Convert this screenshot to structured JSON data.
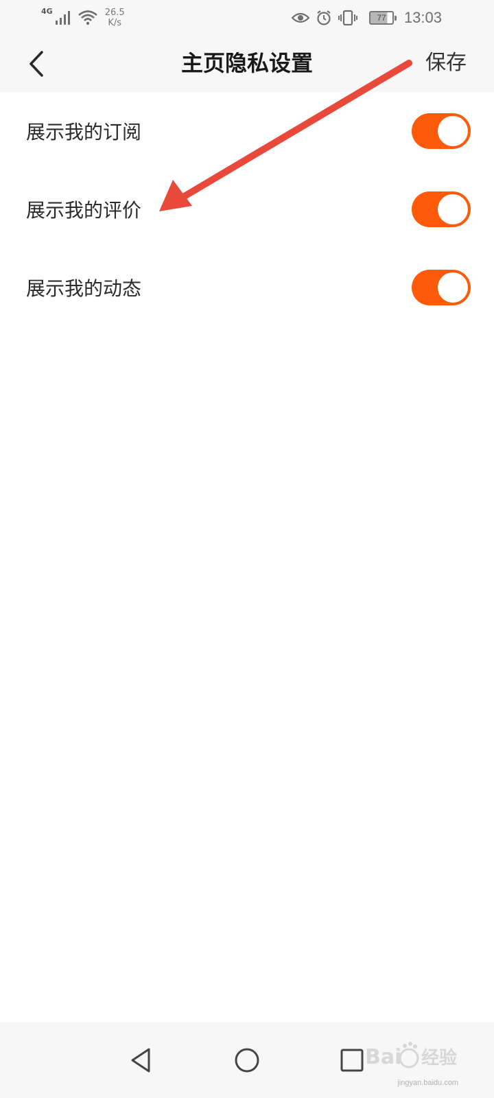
{
  "status_bar": {
    "network": "4G",
    "speed_value": "26.5",
    "speed_unit": "K/s",
    "battery_level": "77",
    "time": "13:03",
    "icons": [
      "signal-bars-icon",
      "wifi-icon",
      "eye-icon",
      "alarm-icon",
      "vibrate-icon",
      "battery-icon"
    ]
  },
  "header": {
    "title": "主页隐私设置",
    "save_label": "保存",
    "back_icon": "chevron-left-icon"
  },
  "settings": [
    {
      "label": "展示我的订阅",
      "enabled": true
    },
    {
      "label": "展示我的评价",
      "enabled": true
    },
    {
      "label": "展示我的动态",
      "enabled": true
    }
  ],
  "nav_bar": {
    "icons": [
      "nav-back-icon",
      "nav-home-icon",
      "nav-recent-icon"
    ]
  },
  "watermark": {
    "sub_text": "jingyan.baidu.com"
  },
  "colors": {
    "accent": "#ff5a0a",
    "annotation_arrow": "#e8493a",
    "bar_background": "#f7f7f7"
  }
}
